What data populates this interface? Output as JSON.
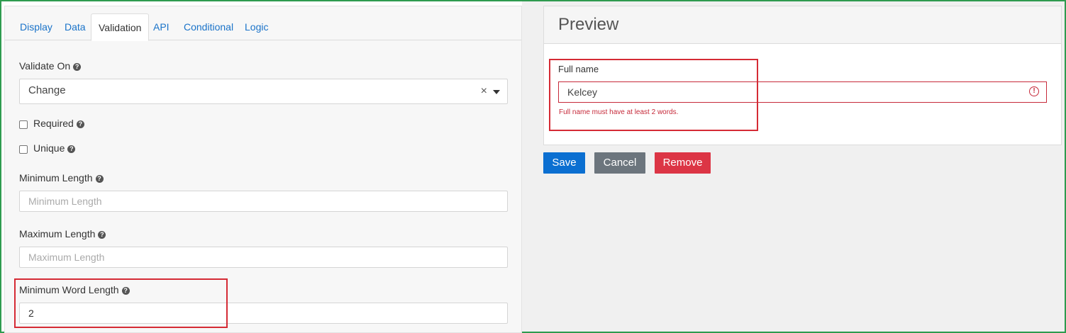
{
  "tabs": [
    {
      "label": "Display"
    },
    {
      "label": "Data"
    },
    {
      "label": "Validation",
      "active": true
    },
    {
      "label": "API"
    },
    {
      "label": "Conditional"
    },
    {
      "label": "Logic"
    }
  ],
  "validation": {
    "validate_on_label": "Validate On",
    "validate_on_value": "Change",
    "required_label": "Required",
    "unique_label": "Unique",
    "min_length_label": "Minimum Length",
    "min_length_placeholder": "Minimum Length",
    "max_length_label": "Maximum Length",
    "max_length_placeholder": "Maximum Length",
    "min_word_length_label": "Minimum Word Length",
    "min_word_length_value": "2"
  },
  "preview": {
    "title": "Preview",
    "field_label": "Full name",
    "field_value": "Kelcey",
    "error_message": "Full name must have at least 2 words."
  },
  "buttons": {
    "save": "Save",
    "cancel": "Cancel",
    "remove": "Remove"
  },
  "colors": {
    "tab_link": "#1a73c9",
    "save": "#0b6fd1",
    "cancel": "#6c757d",
    "remove": "#dc3545",
    "error": "#c62a3a",
    "highlight": "#d52b35",
    "frame": "#2e9b4f"
  }
}
